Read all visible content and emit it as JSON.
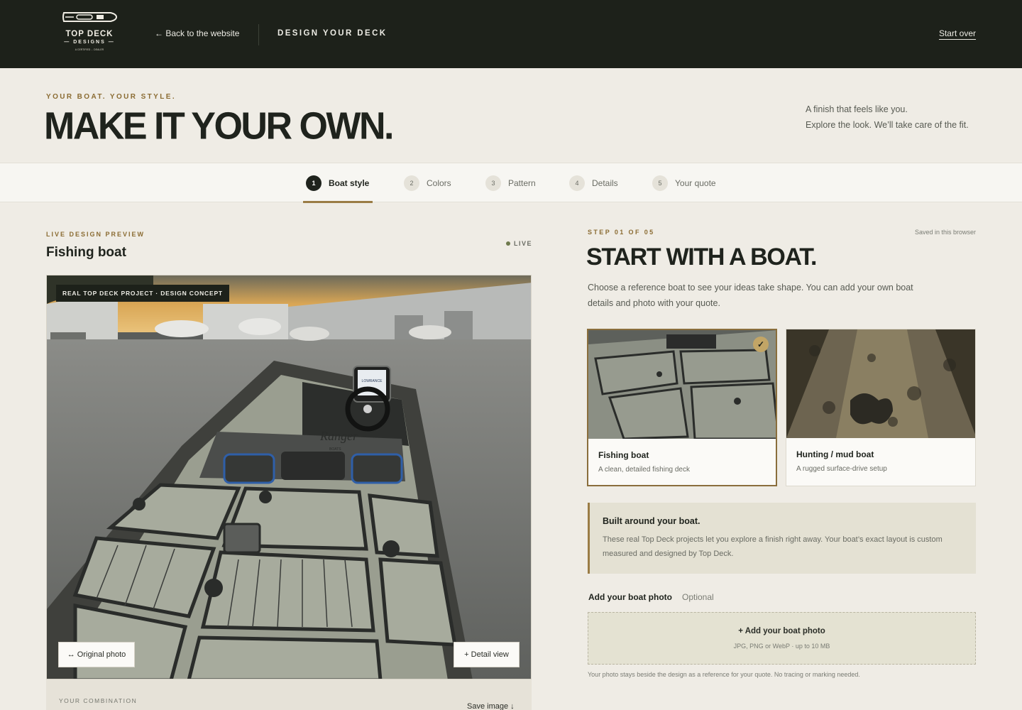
{
  "header": {
    "brand": "TOP DECK",
    "brand_sub": "— DESIGNS —",
    "brand_fine": "A CERTIFIED ... DEALER",
    "back_link": "← Back to the website",
    "section_title": "DESIGN YOUR DECK",
    "start_over": "Start over"
  },
  "hero": {
    "eyebrow": "YOUR BOAT. YOUR STYLE.",
    "title": "MAKE IT YOUR OWN.",
    "tagline_1": "A finish that feels like you.",
    "tagline_2": "Explore the look. We’ll take care of the fit."
  },
  "stepper": {
    "steps": [
      {
        "num": "1",
        "label": "Boat style",
        "active": true
      },
      {
        "num": "2",
        "label": "Colors",
        "active": false
      },
      {
        "num": "3",
        "label": "Pattern",
        "active": false
      },
      {
        "num": "4",
        "label": "Details",
        "active": false
      },
      {
        "num": "5",
        "label": "Your quote",
        "active": false
      }
    ]
  },
  "preview": {
    "eyebrow": "LIVE DESIGN PREVIEW",
    "title": "Fishing boat",
    "live_label": "LIVE",
    "badge": "REAL TOP DECK PROJECT · DESIGN CONCEPT",
    "original_photo_button": "↔ Original photo",
    "detail_view_button": "+ Detail view",
    "combination_label": "YOUR COMBINATION",
    "save_image": "Save image ↓",
    "console_brand": "Ranger",
    "console_brand_sub": "BOATS",
    "screen_brand": "LOWRANCE"
  },
  "panel": {
    "step_count": "STEP 01 OF 05",
    "saved_note": "Saved in this browser",
    "title": "START WITH A BOAT.",
    "intro": "Choose a reference boat to see your ideas take shape. You can add your own boat details and photo with your quote.",
    "cards": [
      {
        "title": "Fishing boat",
        "desc": "A clean, detailed fishing deck",
        "selected": true
      },
      {
        "title": "Hunting / mud boat",
        "desc": "A rugged surface-drive setup",
        "selected": false
      }
    ],
    "check_mark": "✓",
    "note_title": "Built around your boat.",
    "note_body": "These real Top Deck projects let you explore a finish right away. Your boat’s exact layout is custom measured and designed by Top Deck.",
    "photo_label": "Add your boat photo",
    "photo_optional": "Optional",
    "dropzone_title": "+ Add your boat photo",
    "dropzone_sub": "JPG, PNG or WebP · up to 10 MB",
    "fine_print": "Your photo stays beside the design as a reference for your quote. No tracing or marking needed."
  },
  "colors": {
    "header_bg": "#1d211a",
    "page_bg": "#efece5",
    "accent_gold": "#9a7c45",
    "deck_gray": "#8f9486",
    "trim_black": "#2a2c2a"
  }
}
